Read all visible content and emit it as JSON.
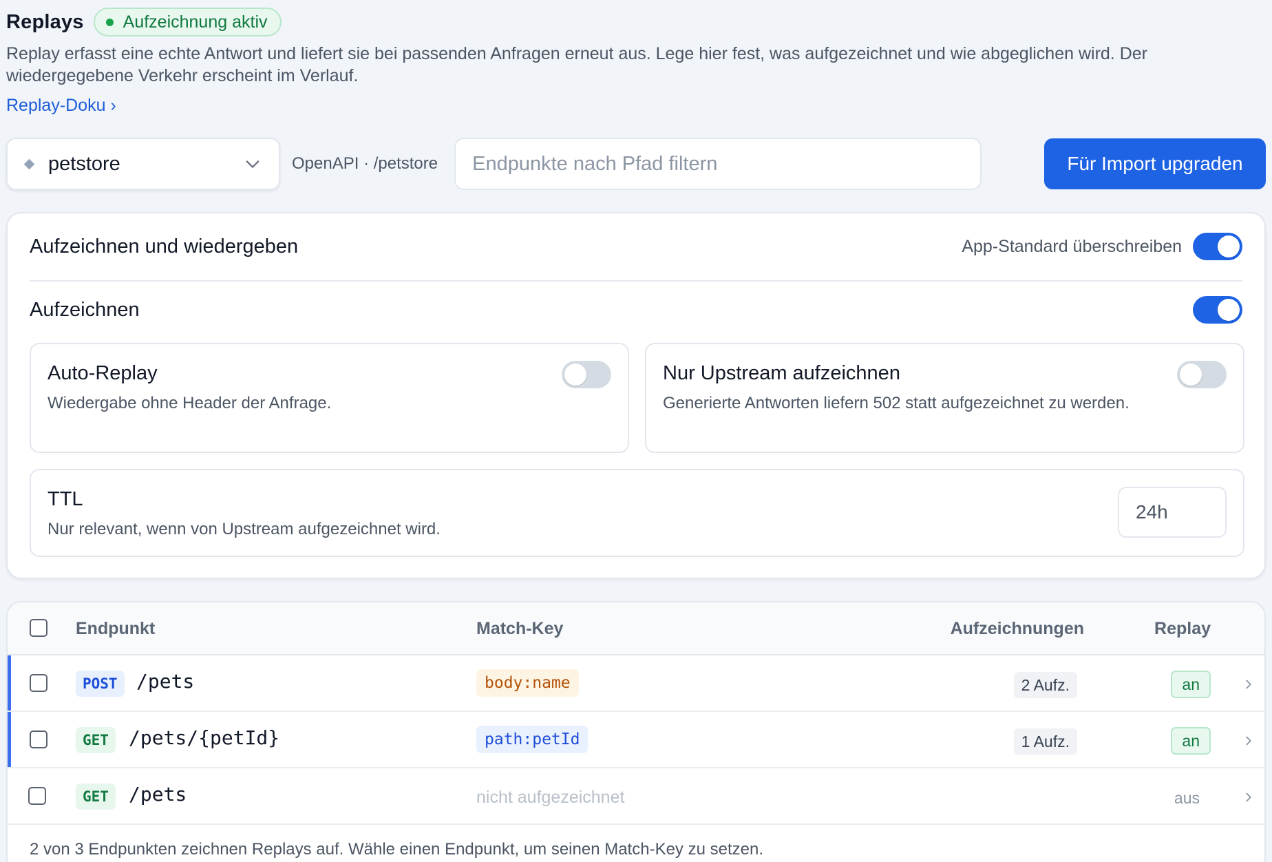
{
  "header": {
    "title": "Replays",
    "status_badge": "Aufzeichnung aktiv",
    "description": "Replay erfasst eine echte Antwort und liefert sie bei passenden Anfragen erneut aus. Lege hier fest, was aufgezeichnet und wie abgeglichen wird. Der wiedergegebene Verkehr erscheint im Verlauf.",
    "doc_link": "Replay-Doku ›"
  },
  "toolbar": {
    "app_name": "petstore",
    "source_label": "OpenAPI · /petstore",
    "search_placeholder": "Endpunkte nach Pfad filtern",
    "search_value": "",
    "upgrade_button": "Für Import upgraden"
  },
  "settings": {
    "title": "Aufzeichnen und wiedergeben",
    "override_label": "App-Standard überschreiben",
    "override_on": true,
    "record_label": "Aufzeichnen",
    "record_on": true,
    "auto_replay": {
      "title": "Auto-Replay",
      "description": "Wiedergabe ohne Header der Anfrage.",
      "on": false
    },
    "upstream_only": {
      "title": "Nur Upstream aufzeichnen",
      "description": "Generierte Antworten liefern 502 statt aufgezeichnet zu werden.",
      "on": false
    },
    "ttl": {
      "title": "TTL",
      "description": "Nur relevant, wenn von Upstream aufgezeichnet wird.",
      "value": "24h"
    }
  },
  "table": {
    "columns": {
      "endpoint": "Endpunkt",
      "match_key": "Match-Key",
      "recordings": "Aufzeichnungen",
      "replay": "Replay"
    },
    "rows": [
      {
        "method": "POST",
        "path": "/pets",
        "match_key": "body:name",
        "recordings": "2 Aufz.",
        "replay": "an"
      },
      {
        "method": "GET",
        "path": "/pets/{petId}",
        "match_key": "path:petId",
        "recordings": "1 Aufz.",
        "replay": "an"
      },
      {
        "method": "GET",
        "path": "/pets",
        "match_key": "nicht aufgezeichnet",
        "recordings": "",
        "replay": "aus"
      }
    ],
    "footer": "2 von 3 Endpunkten zeichnen Replays auf. Wähle einen Endpunkt, um seinen Match-Key zu setzen."
  },
  "colors": {
    "accent": "#1f63e5",
    "success": "#10793f",
    "warning": "#b45309",
    "background": "#f1f4f9"
  },
  "icons": [
    "diamond-icon",
    "chevron-down-icon",
    "chevron-right-icon",
    "status-dot-icon"
  ]
}
